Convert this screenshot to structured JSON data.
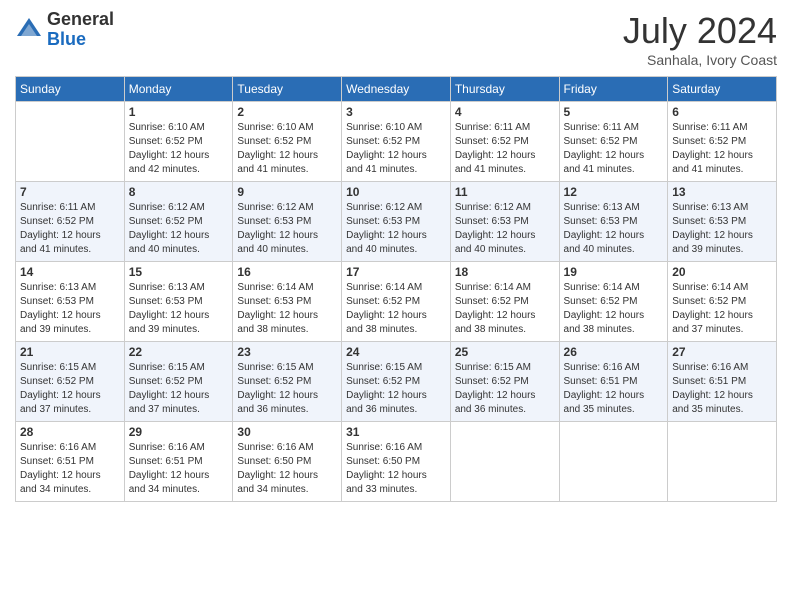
{
  "header": {
    "logo": {
      "line1": "General",
      "line2": "Blue"
    },
    "title": "July 2024",
    "location": "Sanhala, Ivory Coast"
  },
  "days_of_week": [
    "Sunday",
    "Monday",
    "Tuesday",
    "Wednesday",
    "Thursday",
    "Friday",
    "Saturday"
  ],
  "weeks": [
    [
      {
        "day": "",
        "sunrise": "",
        "sunset": "",
        "daylight": ""
      },
      {
        "day": "1",
        "sunrise": "Sunrise: 6:10 AM",
        "sunset": "Sunset: 6:52 PM",
        "daylight": "Daylight: 12 hours and 42 minutes."
      },
      {
        "day": "2",
        "sunrise": "Sunrise: 6:10 AM",
        "sunset": "Sunset: 6:52 PM",
        "daylight": "Daylight: 12 hours and 41 minutes."
      },
      {
        "day": "3",
        "sunrise": "Sunrise: 6:10 AM",
        "sunset": "Sunset: 6:52 PM",
        "daylight": "Daylight: 12 hours and 41 minutes."
      },
      {
        "day": "4",
        "sunrise": "Sunrise: 6:11 AM",
        "sunset": "Sunset: 6:52 PM",
        "daylight": "Daylight: 12 hours and 41 minutes."
      },
      {
        "day": "5",
        "sunrise": "Sunrise: 6:11 AM",
        "sunset": "Sunset: 6:52 PM",
        "daylight": "Daylight: 12 hours and 41 minutes."
      },
      {
        "day": "6",
        "sunrise": "Sunrise: 6:11 AM",
        "sunset": "Sunset: 6:52 PM",
        "daylight": "Daylight: 12 hours and 41 minutes."
      }
    ],
    [
      {
        "day": "7",
        "sunrise": "Sunrise: 6:11 AM",
        "sunset": "Sunset: 6:52 PM",
        "daylight": "Daylight: 12 hours and 41 minutes."
      },
      {
        "day": "8",
        "sunrise": "Sunrise: 6:12 AM",
        "sunset": "Sunset: 6:52 PM",
        "daylight": "Daylight: 12 hours and 40 minutes."
      },
      {
        "day": "9",
        "sunrise": "Sunrise: 6:12 AM",
        "sunset": "Sunset: 6:53 PM",
        "daylight": "Daylight: 12 hours and 40 minutes."
      },
      {
        "day": "10",
        "sunrise": "Sunrise: 6:12 AM",
        "sunset": "Sunset: 6:53 PM",
        "daylight": "Daylight: 12 hours and 40 minutes."
      },
      {
        "day": "11",
        "sunrise": "Sunrise: 6:12 AM",
        "sunset": "Sunset: 6:53 PM",
        "daylight": "Daylight: 12 hours and 40 minutes."
      },
      {
        "day": "12",
        "sunrise": "Sunrise: 6:13 AM",
        "sunset": "Sunset: 6:53 PM",
        "daylight": "Daylight: 12 hours and 40 minutes."
      },
      {
        "day": "13",
        "sunrise": "Sunrise: 6:13 AM",
        "sunset": "Sunset: 6:53 PM",
        "daylight": "Daylight: 12 hours and 39 minutes."
      }
    ],
    [
      {
        "day": "14",
        "sunrise": "Sunrise: 6:13 AM",
        "sunset": "Sunset: 6:53 PM",
        "daylight": "Daylight: 12 hours and 39 minutes."
      },
      {
        "day": "15",
        "sunrise": "Sunrise: 6:13 AM",
        "sunset": "Sunset: 6:53 PM",
        "daylight": "Daylight: 12 hours and 39 minutes."
      },
      {
        "day": "16",
        "sunrise": "Sunrise: 6:14 AM",
        "sunset": "Sunset: 6:53 PM",
        "daylight": "Daylight: 12 hours and 38 minutes."
      },
      {
        "day": "17",
        "sunrise": "Sunrise: 6:14 AM",
        "sunset": "Sunset: 6:52 PM",
        "daylight": "Daylight: 12 hours and 38 minutes."
      },
      {
        "day": "18",
        "sunrise": "Sunrise: 6:14 AM",
        "sunset": "Sunset: 6:52 PM",
        "daylight": "Daylight: 12 hours and 38 minutes."
      },
      {
        "day": "19",
        "sunrise": "Sunrise: 6:14 AM",
        "sunset": "Sunset: 6:52 PM",
        "daylight": "Daylight: 12 hours and 38 minutes."
      },
      {
        "day": "20",
        "sunrise": "Sunrise: 6:14 AM",
        "sunset": "Sunset: 6:52 PM",
        "daylight": "Daylight: 12 hours and 37 minutes."
      }
    ],
    [
      {
        "day": "21",
        "sunrise": "Sunrise: 6:15 AM",
        "sunset": "Sunset: 6:52 PM",
        "daylight": "Daylight: 12 hours and 37 minutes."
      },
      {
        "day": "22",
        "sunrise": "Sunrise: 6:15 AM",
        "sunset": "Sunset: 6:52 PM",
        "daylight": "Daylight: 12 hours and 37 minutes."
      },
      {
        "day": "23",
        "sunrise": "Sunrise: 6:15 AM",
        "sunset": "Sunset: 6:52 PM",
        "daylight": "Daylight: 12 hours and 36 minutes."
      },
      {
        "day": "24",
        "sunrise": "Sunrise: 6:15 AM",
        "sunset": "Sunset: 6:52 PM",
        "daylight": "Daylight: 12 hours and 36 minutes."
      },
      {
        "day": "25",
        "sunrise": "Sunrise: 6:15 AM",
        "sunset": "Sunset: 6:52 PM",
        "daylight": "Daylight: 12 hours and 36 minutes."
      },
      {
        "day": "26",
        "sunrise": "Sunrise: 6:16 AM",
        "sunset": "Sunset: 6:51 PM",
        "daylight": "Daylight: 12 hours and 35 minutes."
      },
      {
        "day": "27",
        "sunrise": "Sunrise: 6:16 AM",
        "sunset": "Sunset: 6:51 PM",
        "daylight": "Daylight: 12 hours and 35 minutes."
      }
    ],
    [
      {
        "day": "28",
        "sunrise": "Sunrise: 6:16 AM",
        "sunset": "Sunset: 6:51 PM",
        "daylight": "Daylight: 12 hours and 34 minutes."
      },
      {
        "day": "29",
        "sunrise": "Sunrise: 6:16 AM",
        "sunset": "Sunset: 6:51 PM",
        "daylight": "Daylight: 12 hours and 34 minutes."
      },
      {
        "day": "30",
        "sunrise": "Sunrise: 6:16 AM",
        "sunset": "Sunset: 6:50 PM",
        "daylight": "Daylight: 12 hours and 34 minutes."
      },
      {
        "day": "31",
        "sunrise": "Sunrise: 6:16 AM",
        "sunset": "Sunset: 6:50 PM",
        "daylight": "Daylight: 12 hours and 33 minutes."
      },
      {
        "day": "",
        "sunrise": "",
        "sunset": "",
        "daylight": ""
      },
      {
        "day": "",
        "sunrise": "",
        "sunset": "",
        "daylight": ""
      },
      {
        "day": "",
        "sunrise": "",
        "sunset": "",
        "daylight": ""
      }
    ]
  ]
}
